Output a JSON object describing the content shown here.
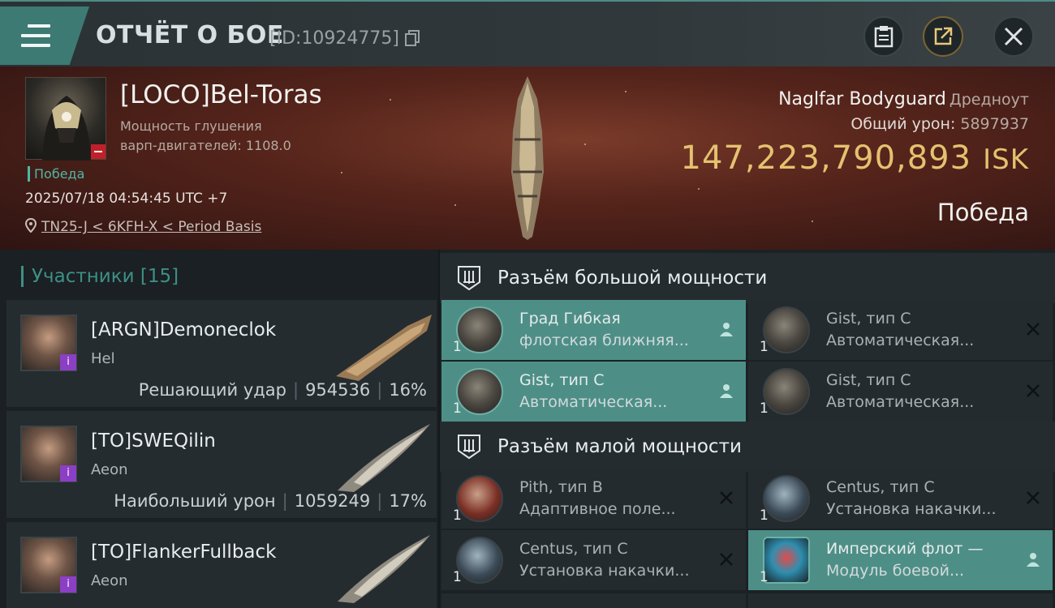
{
  "header": {
    "title": "ОТЧЁТ О БОЕ",
    "id_label": "[ID:10924775]"
  },
  "victim": {
    "name": "[LOCO]Bel-Toras",
    "subline1": "Мощность глушения",
    "subline2": "варп-двигателей: 1108.0",
    "status": "Победа",
    "datetime": "2025/07/18 04:54:45 UTC +7",
    "location": "TN25-J < 6KFH-X < Period Basis"
  },
  "ship": {
    "name": "Naglfar Bodyguard",
    "class": "Дредноут",
    "damage_label": "Общий урон:",
    "damage_value": "5897937",
    "isk_value": "147,223,790,893",
    "isk_unit": "ISK",
    "result": "Победа"
  },
  "participants": {
    "title": "Участники [15]",
    "items": [
      {
        "name": "[ARGN]Demoneclok",
        "ship": "Hel",
        "role": "Решающий удар",
        "damage": "954536",
        "percent": "16%"
      },
      {
        "name": "[TO]SWEQilin",
        "ship": "Aeon",
        "role": "Наибольший урон",
        "damage": "1059249",
        "percent": "17%"
      },
      {
        "name": "[TO]FlankerFullback",
        "ship": "Aeon",
        "role": "",
        "damage": "",
        "percent": ""
      }
    ]
  },
  "high_slots": {
    "title": "Разъём большой мощности",
    "modules": [
      {
        "name": "Град Гибкая",
        "desc": "флотская ближняя...",
        "qty": "1",
        "highlighted": true,
        "action": "person"
      },
      {
        "name": "Gist, тип C",
        "desc": "Автоматическая...",
        "qty": "1",
        "highlighted": false,
        "action": "close"
      },
      {
        "name": "Gist, тип C",
        "desc": "Автоматическая...",
        "qty": "1",
        "highlighted": true,
        "action": "person"
      },
      {
        "name": "Gist, тип C",
        "desc": "Автоматическая...",
        "qty": "1",
        "highlighted": false,
        "action": "close"
      }
    ]
  },
  "low_slots": {
    "title": "Разъём малой мощности",
    "modules": [
      {
        "name": "Pith, тип B",
        "desc": "Адаптивное поле...",
        "qty": "1",
        "highlighted": false,
        "action": "close"
      },
      {
        "name": "Centus, тип C",
        "desc": "Установка накачки...",
        "qty": "1",
        "highlighted": false,
        "action": "close"
      },
      {
        "name": "Centus, тип C",
        "desc": "Установка накачки...",
        "qty": "1",
        "highlighted": false,
        "action": "close"
      },
      {
        "name": "Имперский флот —",
        "desc": "Модуль боевой...",
        "qty": "1",
        "highlighted": true,
        "action": "person"
      }
    ]
  },
  "colors": {
    "accent_teal": "#4d8f86",
    "isk_gold": "#e5c170",
    "corp_badge": "#8b3fc4"
  }
}
